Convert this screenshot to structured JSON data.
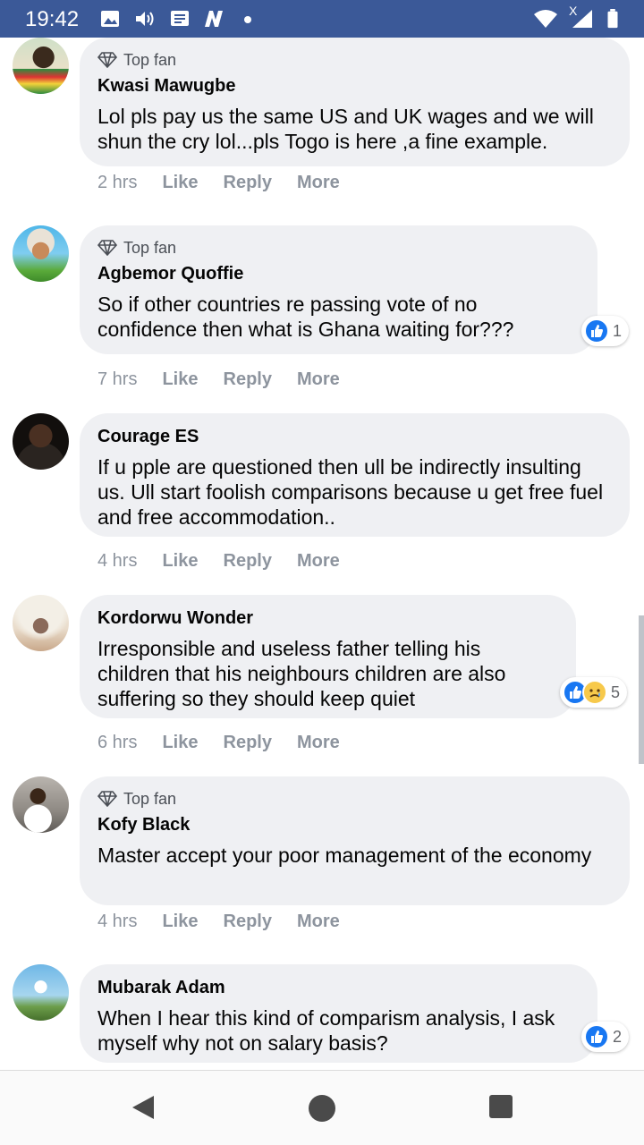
{
  "status_bar": {
    "time": "19:42",
    "network_label": "X"
  },
  "comments": [
    {
      "badge": "Top fan",
      "author": "Kwasi Mawugbe",
      "text": "Lol pls pay us the same US and UK wages and we will shun the cry lol...pls Togo is here ,a fine example.",
      "time": "2 hrs",
      "like": "Like",
      "reply": "Reply",
      "more": "More"
    },
    {
      "badge": "Top fan",
      "author": "Agbemor Quoffie",
      "text": "So if other countries re passing vote of no confidence then what is Ghana waiting for???",
      "time": "7 hrs",
      "like": "Like",
      "reply": "Reply",
      "more": "More",
      "reaction_count": "1"
    },
    {
      "author": "Courage ES",
      "text": "If u pple are questioned then ull be indirectly insulting us. Ull start foolish comparisons because u get free fuel and free accommodation..",
      "time": "4 hrs",
      "like": "Like",
      "reply": "Reply",
      "more": "More"
    },
    {
      "author": "Kordorwu Wonder",
      "text": "Irresponsible and useless father telling his children that his neighbours children are also suffering so they should keep quiet",
      "time": "6 hrs",
      "like": "Like",
      "reply": "Reply",
      "more": "More",
      "reaction_count": "5"
    },
    {
      "badge": "Top fan",
      "author": "Kofy Black",
      "text": "Master accept your poor management of the economy",
      "time": "4 hrs",
      "like": "Like",
      "reply": "Reply",
      "more": "More"
    },
    {
      "author": "Mubarak Adam",
      "text": "When I hear this kind of comparism analysis, I ask myself why not on salary basis?",
      "reaction_count": "2"
    }
  ],
  "colors": {
    "status_bar": "#3b5998",
    "bubble": "#eff0f3",
    "like_blue": "#1877f2",
    "meta_gray": "#8d949e"
  }
}
